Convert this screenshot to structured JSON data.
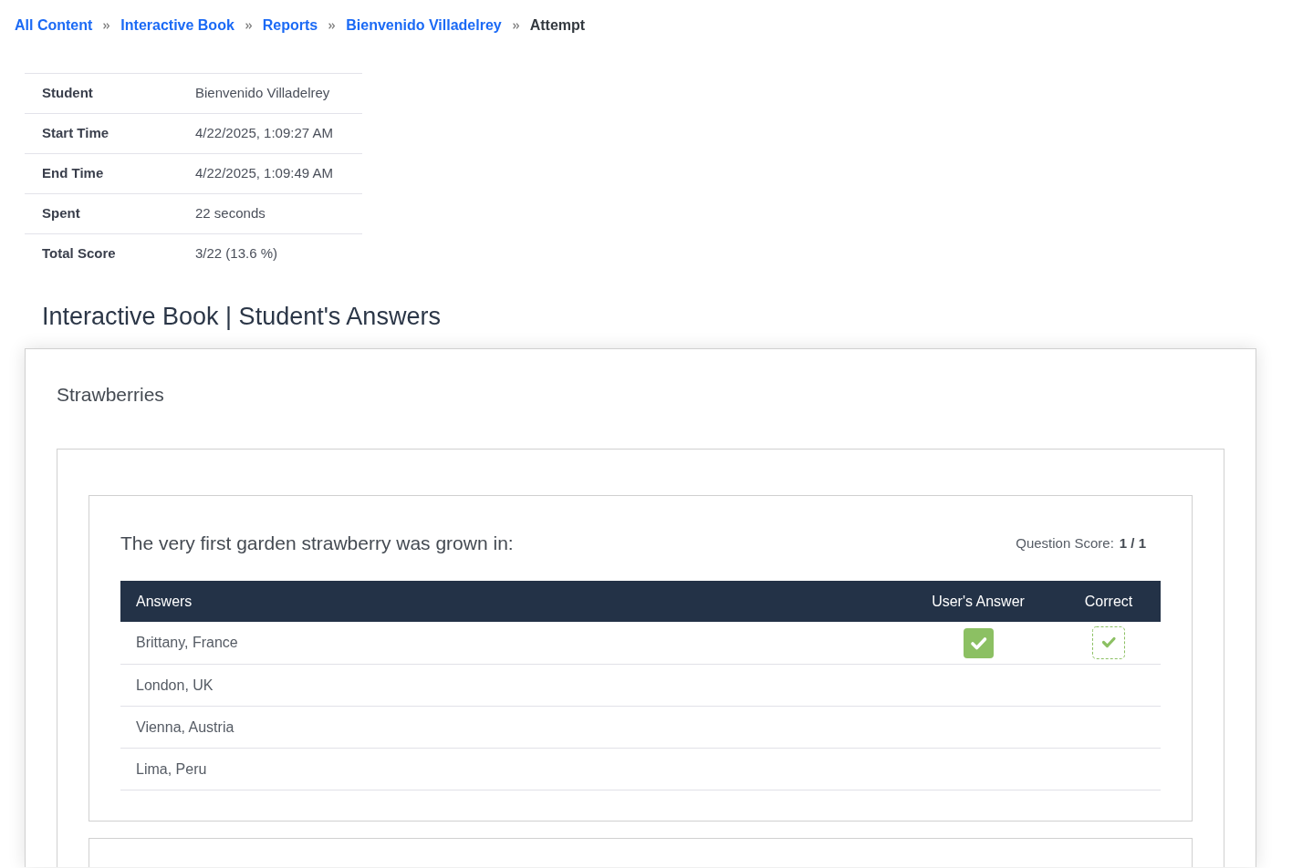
{
  "breadcrumb": [
    {
      "label": "All Content",
      "current": false
    },
    {
      "label": "Interactive Book",
      "current": false
    },
    {
      "label": "Reports",
      "current": false
    },
    {
      "label": "Bienvenido Villadelrey",
      "current": false
    },
    {
      "label": "Attempt",
      "current": true
    }
  ],
  "summary": [
    {
      "label": "Student",
      "value": "Bienvenido Villadelrey"
    },
    {
      "label": "Start Time",
      "value": "4/22/2025, 1:09:27 AM"
    },
    {
      "label": "End Time",
      "value": "4/22/2025, 1:09:49 AM"
    },
    {
      "label": "Spent",
      "value": "22 seconds"
    },
    {
      "label": "Total Score",
      "value": "3/22 (13.6 %)"
    }
  ],
  "heading": "Interactive Book | Student's Answers",
  "section": {
    "title": "Strawberries",
    "questions": [
      {
        "text": "The very first garden strawberry was grown in:",
        "score_label": "Question Score:",
        "score": "1 / 1",
        "columns": [
          "Answers",
          "User's Answer",
          "Correct"
        ],
        "rows": [
          {
            "answer": "Brittany, France",
            "user_answer": true,
            "correct": true
          },
          {
            "answer": "London, UK",
            "user_answer": false,
            "correct": false
          },
          {
            "answer": "Vienna, Austria",
            "user_answer": false,
            "correct": false
          },
          {
            "answer": "Lima, Peru",
            "user_answer": false,
            "correct": false
          }
        ]
      }
    ]
  }
}
